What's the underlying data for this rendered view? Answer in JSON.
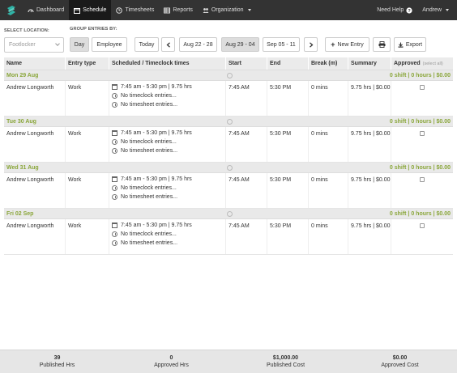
{
  "nav": {
    "logo": "logo-icon",
    "items": [
      {
        "label": "Dashboard",
        "icon": "dashboard-icon",
        "active": false
      },
      {
        "label": "Schedule",
        "icon": "calendar-icon",
        "active": true
      },
      {
        "label": "Timesheets",
        "icon": "clock-icon",
        "active": false
      },
      {
        "label": "Reports",
        "icon": "table-icon",
        "active": false
      },
      {
        "label": "Organization",
        "icon": "users-icon",
        "active": false
      }
    ],
    "help_label": "Need Help",
    "user_label": "Andrew"
  },
  "filters": {
    "location_label": "SELECT LOCATION:",
    "location_value": "Footlocker",
    "group_label": "GROUP ENTRIES BY:",
    "group_day": "Day",
    "group_employee": "Employee",
    "today": "Today",
    "weeks": [
      "Aug 22 - 28",
      "Aug 29 - 04",
      "Sep 05 - 11"
    ],
    "new_entry": "New Entry",
    "export": "Export"
  },
  "table": {
    "headers": [
      "Name",
      "Entry type",
      "Scheduled / Timeclock times",
      "Start",
      "End",
      "Break (m)",
      "Summary",
      "Approved"
    ],
    "select_all": "(select all)",
    "days": [
      {
        "label": "Mon 29 Aug",
        "summary": "0 shift | 0 hours | $0.00",
        "entry": {
          "name": "Andrew Longworth",
          "type": "Work",
          "scheduled": "7:45 am - 5:30 pm | 9.75 hrs",
          "timeclock": "No timeclock entries...",
          "timesheet": "No timesheet entries...",
          "start": "7:45 AM",
          "end": "5:30 PM",
          "break": "0 mins",
          "summary": "9.75 hrs | $0.00"
        }
      },
      {
        "label": "Tue 30 Aug",
        "summary": "0 shift | 0 hours | $0.00",
        "entry": {
          "name": "Andrew Longworth",
          "type": "Work",
          "scheduled": "7:45 am - 5:30 pm | 9.75 hrs",
          "timeclock": "No timeclock entries...",
          "timesheet": "No timesheet entries...",
          "start": "7:45 AM",
          "end": "5:30 PM",
          "break": "0 mins",
          "summary": "9.75 hrs | $0.00"
        }
      },
      {
        "label": "Wed 31 Aug",
        "summary": "0 shift | 0 hours | $0.00",
        "entry": {
          "name": "Andrew Longworth",
          "type": "Work",
          "scheduled": "7:45 am - 5:30 pm | 9.75 hrs",
          "timeclock": "No timeclock entries...",
          "timesheet": "No timesheet entries...",
          "start": "7:45 AM",
          "end": "5:30 PM",
          "break": "0 mins",
          "summary": "9.75 hrs | $0.00"
        }
      },
      {
        "label": "Fri 02 Sep",
        "summary": "0 shift | 0 hours | $0.00",
        "entry": {
          "name": "Andrew Longworth",
          "type": "Work",
          "scheduled": "7:45 am - 5:30 pm | 9.75 hrs",
          "timeclock": "No timeclock entries...",
          "timesheet": "No timesheet entries...",
          "start": "7:45 AM",
          "end": "5:30 PM",
          "break": "0 mins",
          "summary": "9.75 hrs | $0.00"
        }
      }
    ]
  },
  "footer": {
    "stats": [
      {
        "value": "39",
        "label": "Published Hrs"
      },
      {
        "value": "0",
        "label": "Approved Hrs"
      },
      {
        "value": "$1,000.00",
        "label": "Published Cost"
      },
      {
        "value": "$0.00",
        "label": "Approved Cost"
      }
    ]
  },
  "colors": {
    "nav_bg": "#333333",
    "day_accent": "#8aa63a",
    "logo": "#2fb3a6"
  }
}
